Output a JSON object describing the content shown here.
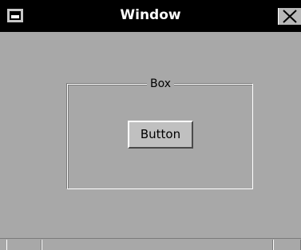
{
  "window": {
    "title": "Window"
  },
  "groupbox": {
    "label": "Box"
  },
  "button": {
    "label": "Button"
  },
  "icons": {
    "system_menu": "system-menu-icon",
    "close": "close-icon"
  },
  "colors": {
    "titlebar": "#000000",
    "title_text": "#ffffff",
    "background": "#a8a8a8"
  }
}
